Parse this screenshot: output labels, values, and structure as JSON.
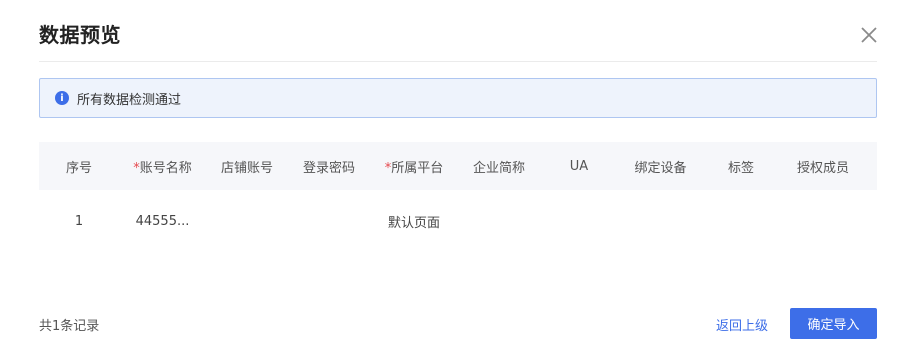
{
  "modal": {
    "title": "数据预览"
  },
  "alert": {
    "icon": "info-icon",
    "icon_glyph": "i",
    "message": "所有数据检测通过",
    "color": "#3d6ee8"
  },
  "table": {
    "columns": [
      {
        "label": "序号",
        "required": false
      },
      {
        "label": "账号名称",
        "required": true
      },
      {
        "label": "店铺账号",
        "required": false
      },
      {
        "label": "登录密码",
        "required": false
      },
      {
        "label": "所属平台",
        "required": true
      },
      {
        "label": "企业简称",
        "required": false
      },
      {
        "label": "UA",
        "required": false
      },
      {
        "label": "绑定设备",
        "required": false
      },
      {
        "label": "标签",
        "required": false
      },
      {
        "label": "授权成员",
        "required": false
      }
    ],
    "required_mark": "*",
    "rows": [
      [
        "1",
        "44555...",
        "",
        "",
        "默认页面",
        "",
        "",
        "",
        "",
        ""
      ]
    ]
  },
  "footer": {
    "count_text": "共1条记录",
    "back_label": "返回上级",
    "confirm_label": "确定导入",
    "accent_color": "#3d6ee8"
  }
}
